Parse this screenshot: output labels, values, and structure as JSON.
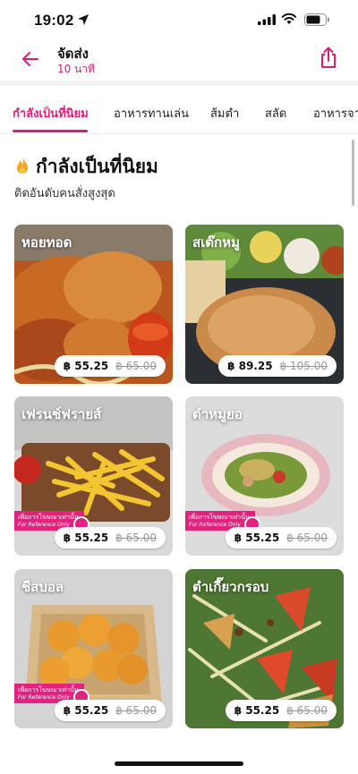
{
  "status_bar": {
    "time": "19:02"
  },
  "header": {
    "title": "จัดส่ง",
    "subtitle": "10 นาที"
  },
  "tabs": [
    {
      "label": "กำลังเป็นที่นิยม",
      "active": true
    },
    {
      "label": "อาหารทานเล่น"
    },
    {
      "label": "ส้มตำ"
    },
    {
      "label": "สลัด"
    },
    {
      "label": "อาหารจาน"
    }
  ],
  "section": {
    "title": "กำลังเป็นที่นิยม",
    "subtitle": "ติดอันดับคนสั่งสูงสุด"
  },
  "reference_badge": {
    "line1": "เพื่อการโฆษณาเท่านั้น",
    "line2": "For Reference Only"
  },
  "items": [
    {
      "name": "หอยทอด",
      "price": "฿ 55.25",
      "old_price": "฿ 65.00"
    },
    {
      "name": "สเต๊กหมู",
      "price": "฿ 89.25",
      "old_price": "฿ 105.00"
    },
    {
      "name": "เฟรนช์ฟรายส์",
      "price": "฿ 55.25",
      "old_price": "฿ 65.00"
    },
    {
      "name": "ตำหมูยอ",
      "price": "฿ 55.25",
      "old_price": "฿ 65.00"
    },
    {
      "name": "ชีสบอล",
      "price": "฿ 55.25",
      "old_price": "฿ 65.00"
    },
    {
      "name": "ตำเกี๊ยวกรอบ",
      "price": "฿ 55.25",
      "old_price": "฿ 65.00"
    }
  ],
  "colors": {
    "accent": "#d81e78",
    "badge": "#e0237f"
  }
}
